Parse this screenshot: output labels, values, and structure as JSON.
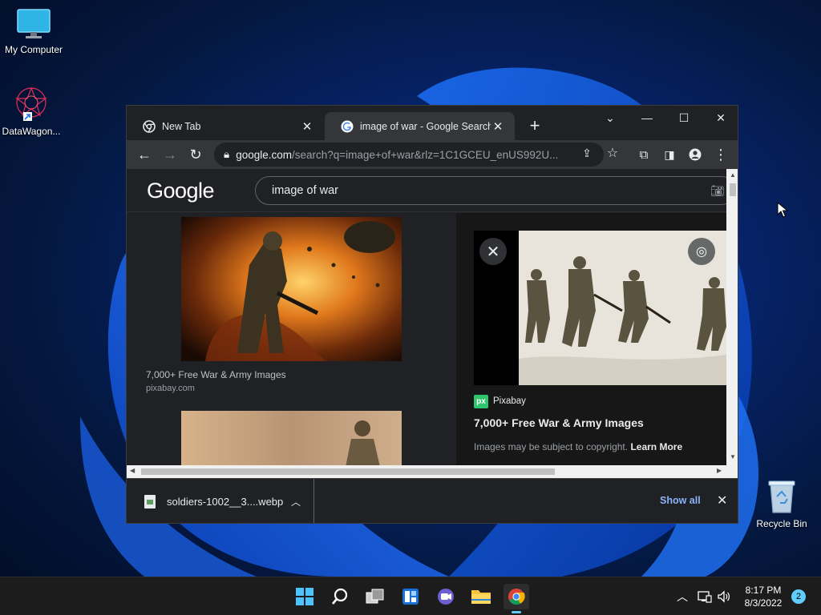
{
  "desktop": {
    "icons": [
      {
        "label": "My Computer"
      },
      {
        "label": "DataWagon..."
      },
      {
        "label": "Recycle Bin"
      }
    ]
  },
  "browser": {
    "tabs": [
      {
        "title": "New Tab",
        "active": false
      },
      {
        "title": "image of war - Google Search",
        "active": true
      }
    ],
    "address": {
      "domain": "google.com",
      "path": "/search?q=image+of+war&rlz=1C1GCEU_enUS992U..."
    },
    "google": {
      "logo": "Google",
      "query": "image of war"
    },
    "results": [
      {
        "title": "7,000+ Free War & Army Images",
        "source": "pixabay.com"
      }
    ],
    "preview": {
      "site_badge": "px",
      "site_name": "Pixabay",
      "title": "7,000+ Free War & Army Images",
      "note": "Images may be subject to copyright.",
      "learn_more": "Learn More"
    },
    "downloads": {
      "file": "soldiers-1002__3....webp",
      "show_all": "Show all"
    }
  },
  "taskbar": {
    "time": "8:17 PM",
    "date": "8/3/2022",
    "notifications": "2",
    "accent": "#60cdff"
  }
}
